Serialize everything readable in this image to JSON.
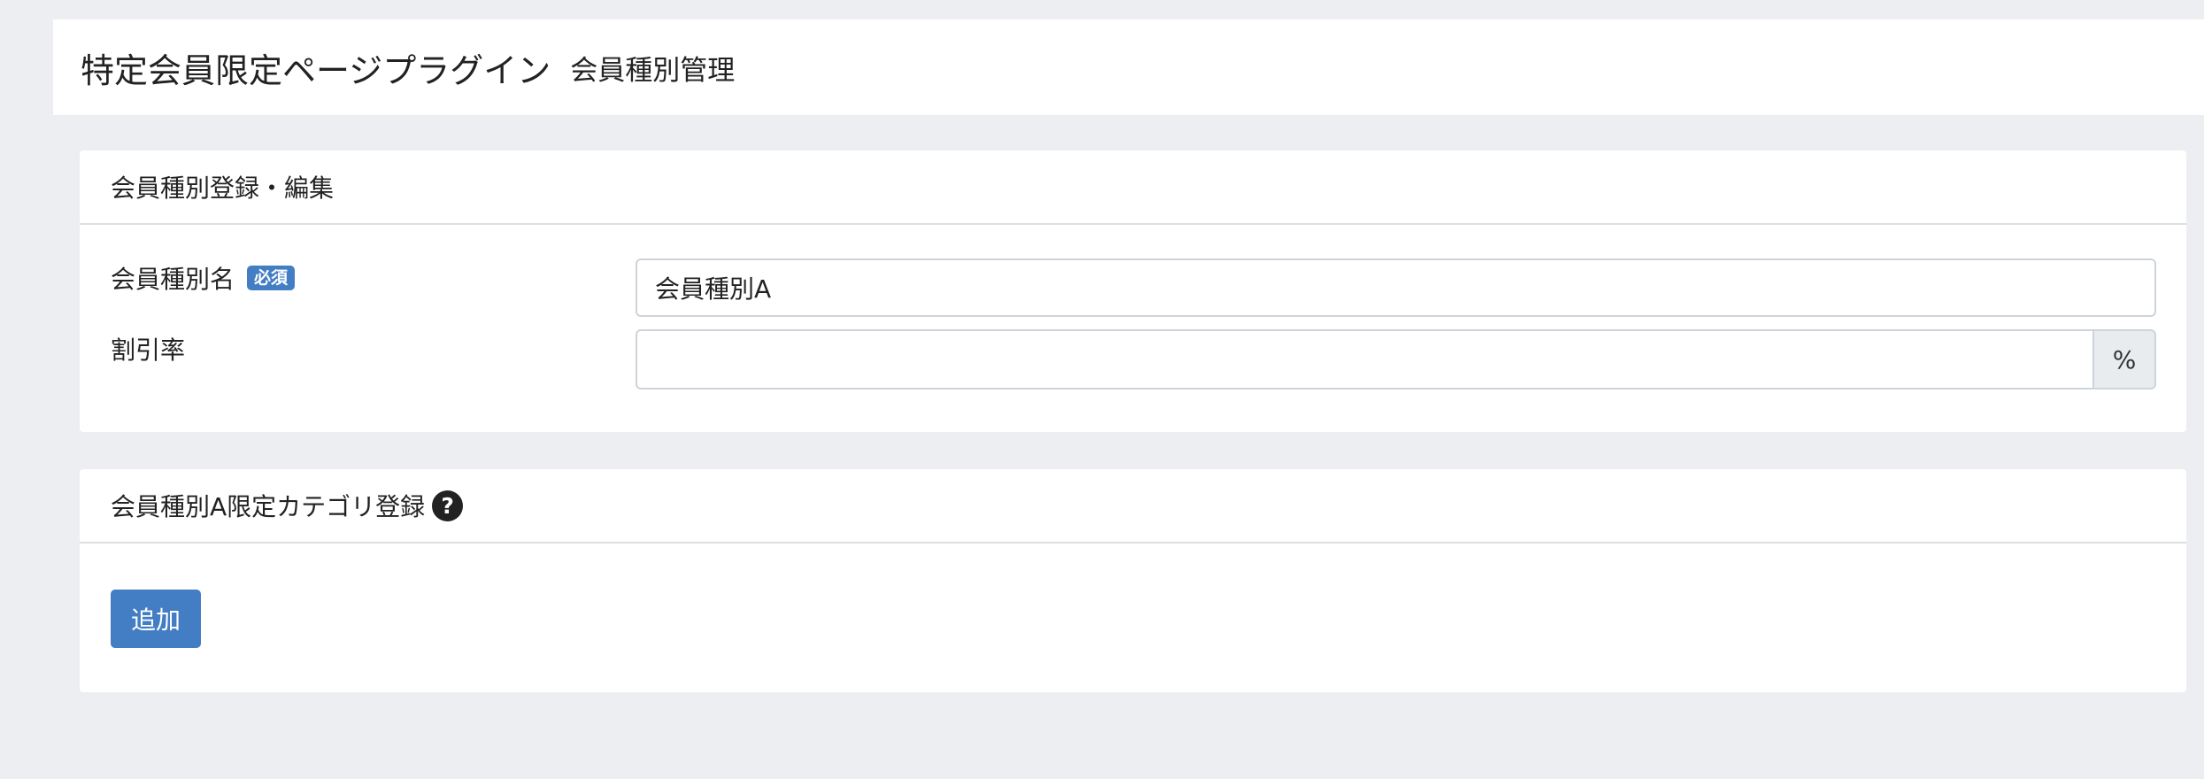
{
  "header": {
    "title": "特定会員限定ページプラグイン",
    "subtitle": "会員種別管理"
  },
  "edit_card": {
    "title": "会員種別登録・編集",
    "name_field": {
      "label": "会員種別名",
      "required_badge": "必須",
      "value": "会員種別A"
    },
    "discount_field": {
      "label": "割引率",
      "value": "",
      "unit": "%"
    }
  },
  "category_card": {
    "title": "会員種別A限定カテゴリ登録",
    "help_icon": "question-circle-icon",
    "add_button_label": "追加"
  },
  "colors": {
    "background": "#eceef2",
    "primary": "#437ec4",
    "card": "#ffffff"
  }
}
